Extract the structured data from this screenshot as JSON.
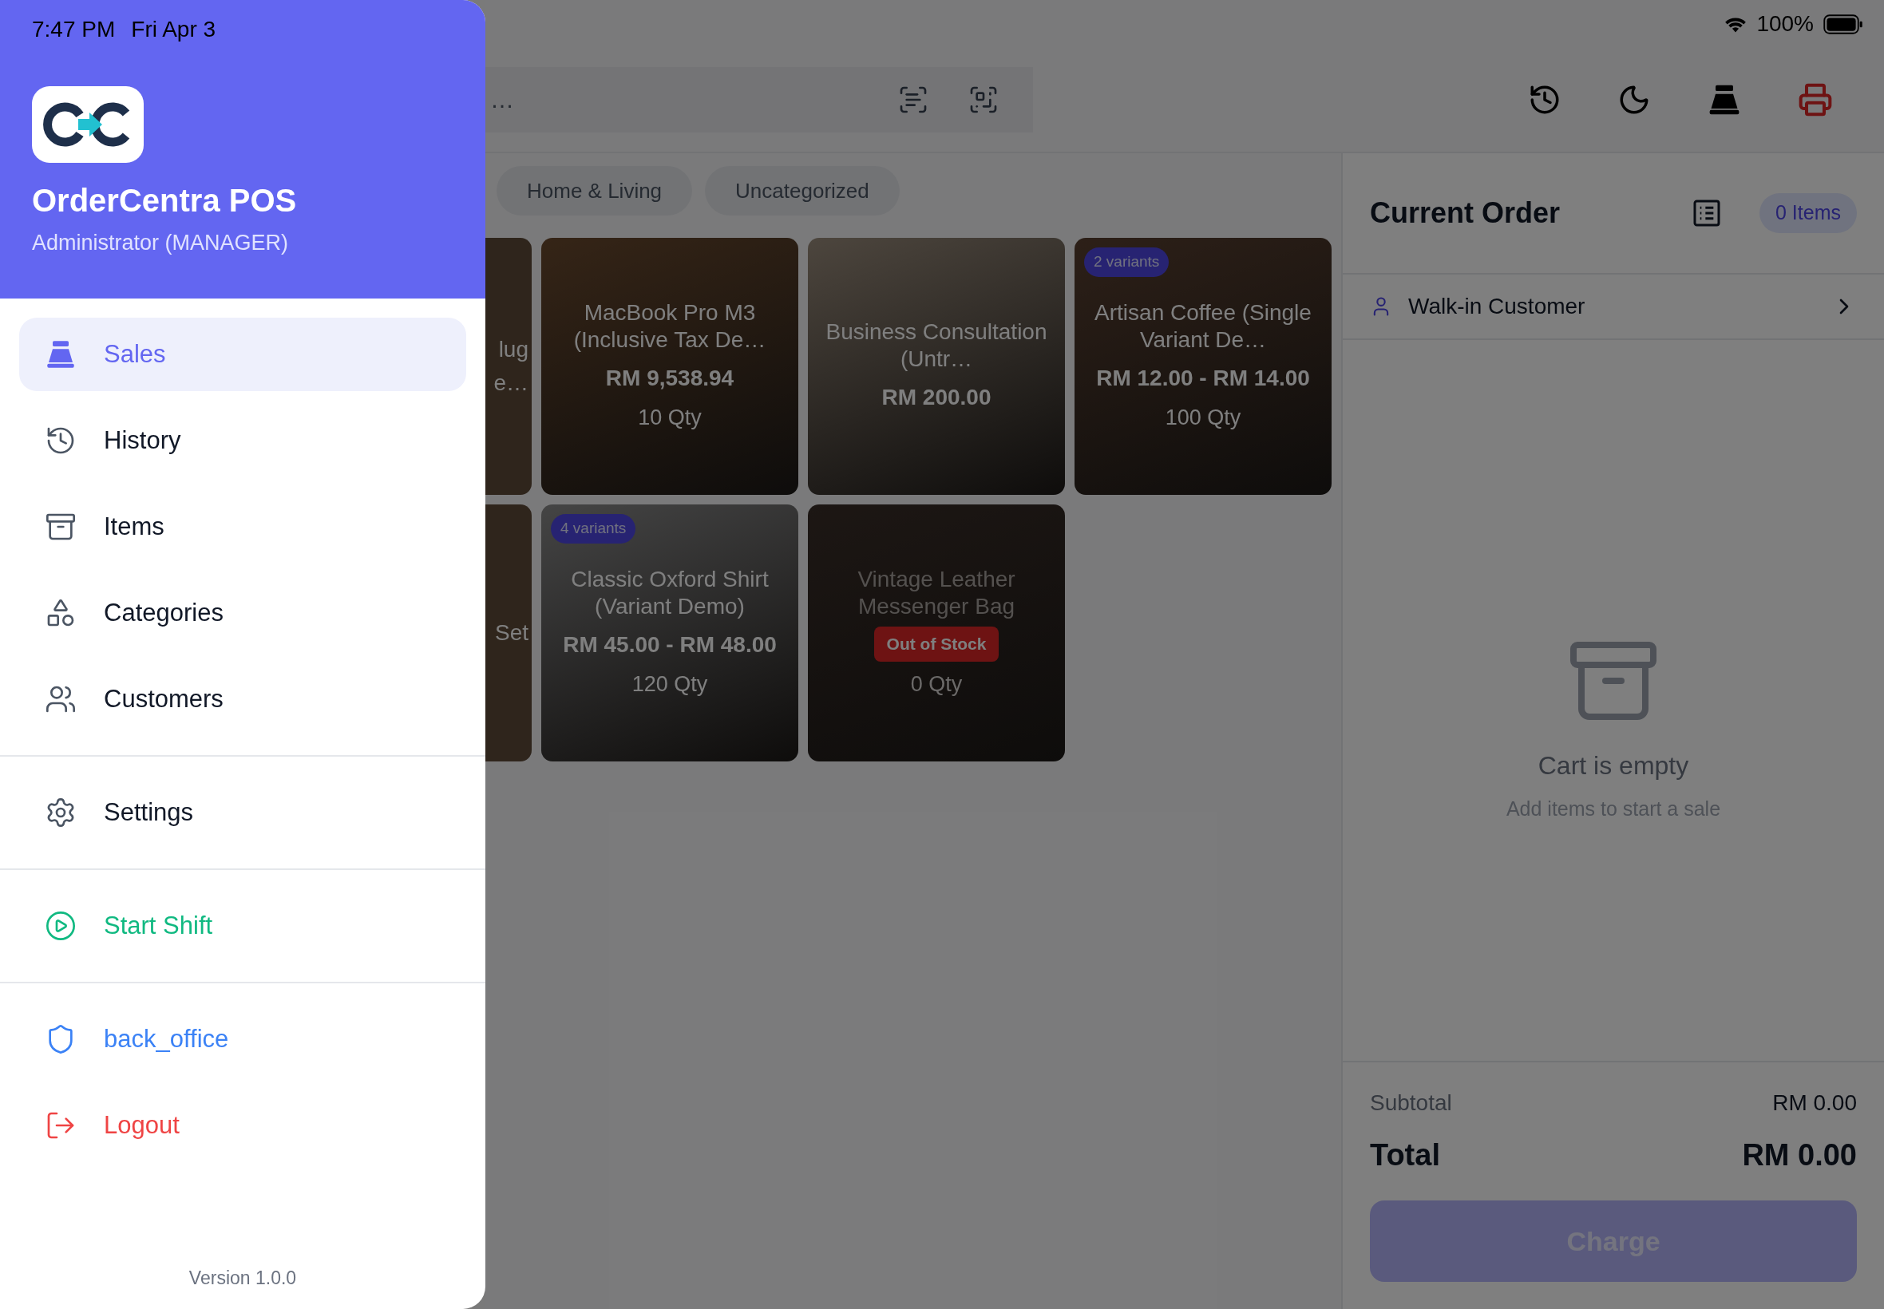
{
  "status_bar": {
    "time": "7:47 PM",
    "date": "Fri Apr 3",
    "battery": "100%"
  },
  "drawer": {
    "app_name": "OrderCentra POS",
    "user": "Administrator (MANAGER)",
    "sections": [
      [
        {
          "label": "Sales",
          "selected": true
        },
        {
          "label": "History",
          "selected": false
        },
        {
          "label": "Items",
          "selected": false
        },
        {
          "label": "Categories",
          "selected": false
        },
        {
          "label": "Customers",
          "selected": false
        }
      ],
      [
        {
          "label": "Settings",
          "selected": false
        }
      ],
      [
        {
          "label": "Start Shift",
          "selected": false
        }
      ],
      [
        {
          "label": "back_office",
          "selected": false
        },
        {
          "label": "Logout",
          "selected": false
        }
      ]
    ],
    "version": "Version 1.0.0"
  },
  "search": {
    "placeholder": "…"
  },
  "categories": [
    "Home & Living",
    "Uncategorized"
  ],
  "product_rows": [
    {
      "partial_lines": [
        "lug",
        "e…"
      ],
      "cards": [
        {
          "name": "MacBook Pro M3 (Inclusive Tax De…",
          "price": "RM 9,538.94",
          "qty": "10 Qty",
          "in_stock": true
        },
        {
          "name": "Business Consultation (Untr…",
          "price": "RM 200.00",
          "in_stock": true
        },
        {
          "name": "Artisan Coffee (Single Variant De…",
          "price": "RM 12.00 - RM 14.00",
          "qty": "100 Qty",
          "badge": "2 variants",
          "in_stock": true
        }
      ]
    },
    {
      "partial_lines": [
        "Set"
      ],
      "cards": [
        {
          "name": "Classic Oxford Shirt (Variant Demo)",
          "price": "RM 45.00 - RM 48.00",
          "qty": "120 Qty",
          "badge": "4 variants",
          "in_stock": true
        },
        {
          "name": "Vintage Leather Messenger Bag",
          "qty": "0 Qty",
          "status": "Out of Stock",
          "in_stock": false
        }
      ]
    }
  ],
  "order": {
    "title": "Current Order",
    "count": "0 Items",
    "customer": "Walk-in Customer",
    "empty_title": "Cart is empty",
    "empty_hint": "Add items to start a sale",
    "subtotal_label": "Subtotal",
    "subtotal": "RM 0.00",
    "total_label": "Total",
    "total": "RM 0.00",
    "charge": "Charge",
    "charge_disabled": true
  }
}
